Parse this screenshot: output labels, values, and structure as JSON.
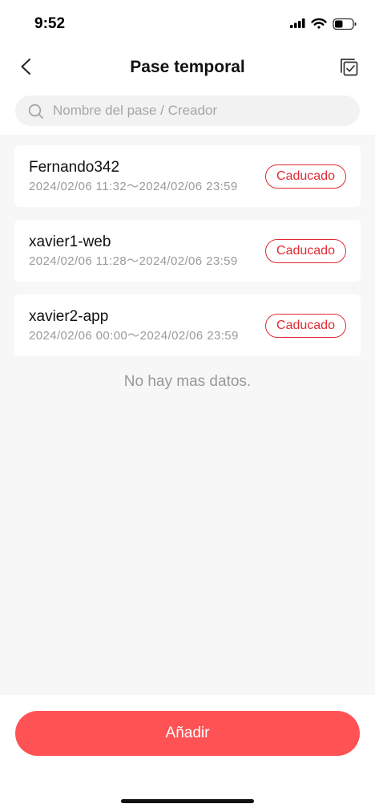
{
  "status_bar": {
    "time": "9:52",
    "battery_level": 0.45
  },
  "header": {
    "title": "Pase temporal"
  },
  "search": {
    "placeholder": "Nombre del pase / Creador",
    "value": ""
  },
  "passes": [
    {
      "name": "Fernando342",
      "period": "2024/02/06 11:32～2024/02/06 23:59",
      "status": "Caducado"
    },
    {
      "name": "xavier1-web",
      "period": "2024/02/06 11:28～2024/02/06 23:59",
      "status": "Caducado"
    },
    {
      "name": "xavier2-app",
      "period": "2024/02/06 00:00～2024/02/06 23:59",
      "status": "Caducado"
    }
  ],
  "list_end_text": "No hay mas datos.",
  "add_button": {
    "label": "Añadir"
  },
  "icons": {
    "back": "chevron-left-icon",
    "select": "multi-select-icon",
    "search": "search-icon",
    "signal": "cellular-signal-icon",
    "wifi": "wifi-icon",
    "battery": "battery-icon"
  },
  "colors": {
    "expired_status": "#e02a33",
    "primary_button": "#ff5255",
    "list_background": "#f7f7f7"
  }
}
